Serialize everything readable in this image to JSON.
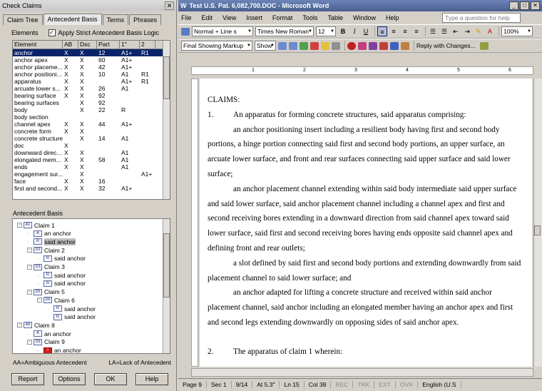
{
  "left": {
    "title": "Check Claims",
    "tabs": [
      "Claim Tree",
      "Antecedent Basis",
      "Terms",
      "Phrases"
    ],
    "elements_label": "Elements",
    "strict_label": "Apply Strict Antecedent Basis Logic",
    "columns": [
      "Element",
      "AB",
      "Dsc",
      "Part",
      "1\"",
      "2"
    ],
    "rows": [
      [
        "anchor",
        "X",
        "X",
        "12",
        "A1+",
        "R1"
      ],
      [
        "anchor apex",
        "X",
        "X",
        "60",
        "A1+",
        ""
      ],
      [
        "anchor placeme...",
        "X",
        "X",
        "42",
        "A1+",
        ""
      ],
      [
        "anchor positioni...",
        "X",
        "X",
        "10",
        "A1",
        "R1"
      ],
      [
        "apparatus",
        "X",
        "X",
        "",
        "A1+",
        "R1"
      ],
      [
        "arcuate lower s...",
        "X",
        "X",
        "26",
        "A1",
        ""
      ],
      [
        "bearing surface",
        "X",
        "X",
        "92",
        "",
        ""
      ],
      [
        "bearing surfaces",
        "",
        "X",
        "92",
        "",
        ""
      ],
      [
        "body",
        "",
        "X",
        "22",
        "R",
        ""
      ],
      [
        "body section",
        "",
        "",
        "",
        "",
        ""
      ],
      [
        "channel apex",
        "X",
        "X",
        "44",
        "A1+",
        ""
      ],
      [
        "concrete form",
        "X",
        "X",
        "",
        "",
        ""
      ],
      [
        "concrete structure",
        "",
        "X",
        "14",
        "A1",
        ""
      ],
      [
        "doc",
        "X",
        "",
        "",
        "",
        ""
      ],
      [
        "downward direc...",
        "X",
        "X",
        "",
        "A1",
        ""
      ],
      [
        "elongated mem...",
        "X",
        "X",
        "58",
        "A1",
        ""
      ],
      [
        "ends",
        "X",
        "X",
        "",
        "A1",
        ""
      ],
      [
        "engagement sur...",
        "",
        "X",
        "",
        "",
        "A1+"
      ],
      [
        "face",
        "X",
        "X",
        "16",
        "",
        ""
      ],
      [
        "first and second...",
        "X",
        "X",
        "32",
        "A1+",
        ""
      ]
    ],
    "ab_label": "Antecedent Basis",
    "tree": [
      {
        "d": 0,
        "badge": "A1",
        "label": "Claim 1",
        "expand": "-"
      },
      {
        "d": 1,
        "badge": "A",
        "label": "an anchor"
      },
      {
        "d": 1,
        "badge": "R",
        "label": "said anchor",
        "sel": true
      },
      {
        "d": 1,
        "badge": "D2",
        "label": "Claim 2",
        "expand": "-"
      },
      {
        "d": 2,
        "badge": "R",
        "label": "said anchor"
      },
      {
        "d": 1,
        "badge": "D3",
        "label": "Claim 3",
        "expand": "-"
      },
      {
        "d": 2,
        "badge": "R",
        "label": "said anchor"
      },
      {
        "d": 2,
        "badge": "R",
        "label": "said anchor"
      },
      {
        "d": 1,
        "badge": "D5",
        "label": "Claim 5",
        "expand": "-"
      },
      {
        "d": 2,
        "badge": "D6",
        "label": "Claim 6",
        "expand": "-"
      },
      {
        "d": 3,
        "badge": "R",
        "label": "said anchor"
      },
      {
        "d": 3,
        "badge": "R",
        "label": "said anchor"
      },
      {
        "d": 0,
        "badge": "A8",
        "label": "Claim 8",
        "expand": "-"
      },
      {
        "d": 1,
        "badge": "A",
        "label": "an anchor"
      },
      {
        "d": 1,
        "badge": "D9",
        "label": "Claim 9",
        "expand": "-"
      },
      {
        "d": 2,
        "badge": "!",
        "label": "an anchor",
        "red": true
      }
    ],
    "legend_aa": "AA=Ambiguous Antecedent",
    "legend_la": "LA=Lack of Antecedent",
    "buttons": [
      "Report",
      "Options",
      "OK",
      "Help"
    ]
  },
  "word": {
    "title": "Test U.S. Pat. 6,082,700.DOC - Microsoft Word",
    "menus": [
      "File",
      "Edit",
      "View",
      "Insert",
      "Format",
      "Tools",
      "Table",
      "Window",
      "Help"
    ],
    "help_placeholder": "Type a question for help",
    "style": "Normal + Line s",
    "font": "Times New Roman",
    "size": "12",
    "zoom": "100%",
    "markup": "Final Showing Markup",
    "show": "Show",
    "reply": "Reply with Changes...",
    "doc": {
      "heading": "CLAIMS:",
      "c1_num": "1.",
      "c1_text": "An apparatus for forming concrete structures, said apparatus comprising:",
      "p1": "an anchor positioning insert including a resilient body having first and second body portions, a hinge portion connecting said first and second body portions, an upper surface, an arcuate lower surface, and front and rear surfaces connecting said upper surface and said lower surface;",
      "p2": "an anchor placement channel extending within said body intermediate said upper surface and said lower surface, said anchor placement channel including a channel apex and first and second receiving bores extending in a downward direction from said channel apex toward said lower surface, said first and second receiving bores having ends opposite said channel apex and defining front and rear outlets;",
      "p3": "a slot defined by said first and second body portions and extending downwardly from said placement channel to said lower surface; and",
      "p4": "an anchor adapted for lifting a concrete structure and received within said anchor placement channel, said anchor including an elongated member having an anchor apex and first and second legs extending downwardly on opposing sides of said anchor apex.",
      "c2_num": "2.",
      "c2_text": "The apparatus of claim 1 wherein:"
    },
    "status": {
      "page": "Page 9",
      "sec": "Sec 1",
      "pages": "9/14",
      "at": "At 5.3\"",
      "ln": "Ln 15",
      "col": "Col 38",
      "rec": "REC",
      "trk": "TRK",
      "ext": "EXT",
      "ovr": "OVR",
      "lang": "English (U.S"
    }
  }
}
